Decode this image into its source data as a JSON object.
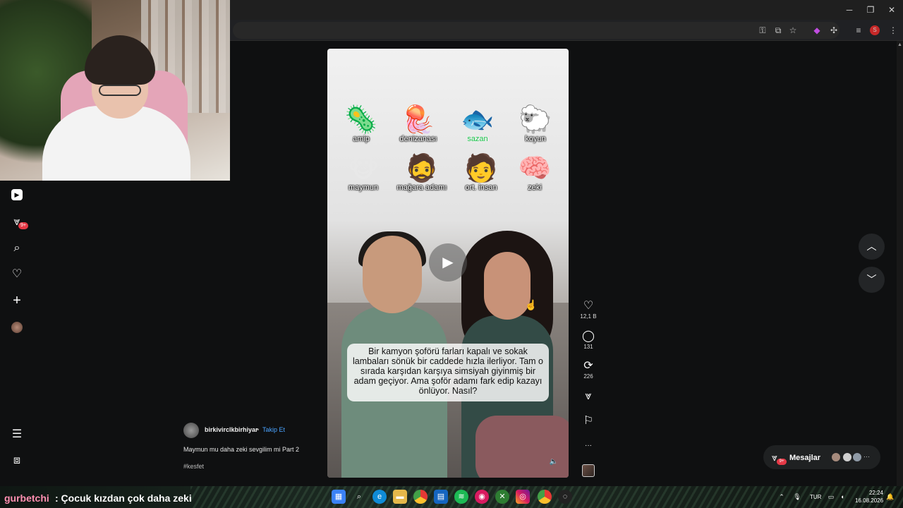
{
  "browser": {
    "minimize_glyph": "─",
    "maximize_glyph": "❐",
    "close_glyph": "✕",
    "toolbar_icons": [
      "key-icon",
      "install-icon",
      "star-icon",
      "extension-puzzle-icon",
      "extensions-icon",
      "media-icon",
      "profile-icon",
      "menu-icon"
    ],
    "profile_letter": "S"
  },
  "left_nav": {
    "items": [
      "home-icon",
      "explore-icon",
      "search-icon",
      "heart-icon",
      "create-icon",
      "profile-avatar"
    ],
    "notification_badge": "9+",
    "bottom_items": [
      "menu-icon",
      "apps-icon"
    ]
  },
  "video": {
    "emoji_grid": [
      {
        "emoji": "🦠",
        "label": "amip",
        "highlight": false
      },
      {
        "emoji": "🪼",
        "label": "denizanası",
        "highlight": false
      },
      {
        "emoji": "🐟",
        "label": "sazan",
        "highlight": true
      },
      {
        "emoji": "🐑",
        "label": "koyun",
        "highlight": false
      },
      {
        "emoji": "🐵",
        "label": "maymun",
        "highlight": false
      },
      {
        "emoji": "🧔",
        "label": "mağara adamı",
        "highlight": false
      },
      {
        "emoji": "🧑",
        "label": "ort. insan",
        "highlight": false
      },
      {
        "emoji": "🧠",
        "label": "zeki",
        "highlight": false
      }
    ],
    "question": "Bir kamyon şoförü farları kapalı ve sokak lambaları sönük bir caddede hızla ilerliyor. Tam o sırada karşıdan karşıya simsiyah giyinmiş bir adam geçiyor. Ama şoför adamı fark edip kazayı önlüyor. Nasıl?",
    "play_glyph": "▶",
    "mute_glyph": "🔈"
  },
  "actions": {
    "likes": "12,1 B",
    "comments": "131",
    "reposts": "226",
    "more": "···"
  },
  "caption": {
    "username": "birkivirclkbirhiyar",
    "separator": "•",
    "follow": "Takip Et",
    "description": "Maymun mu daha zeki sevgilim mi Part 2",
    "hashtag": "#kesfet"
  },
  "messages": {
    "label": "Mesajlar",
    "badge": "9+"
  },
  "stream_chat": {
    "user": "gurbetchi",
    "message": ": Çocuk kızdan çok daha zeki"
  },
  "taskbar": {
    "apps": [
      "files-icon",
      "search-icon",
      "edge-icon",
      "folder-icon",
      "chrome-icon",
      "store-icon",
      "spotify-icon",
      "app-icon",
      "xbox-icon",
      "instagram-icon",
      "chrome-icon",
      "obs-icon"
    ],
    "language": "TUR",
    "time": "22:24",
    "date": "16.08.2026"
  },
  "colors": {
    "background": "#0f1011",
    "accent_red": "#e53946",
    "follow_blue": "#4aa3ff"
  }
}
